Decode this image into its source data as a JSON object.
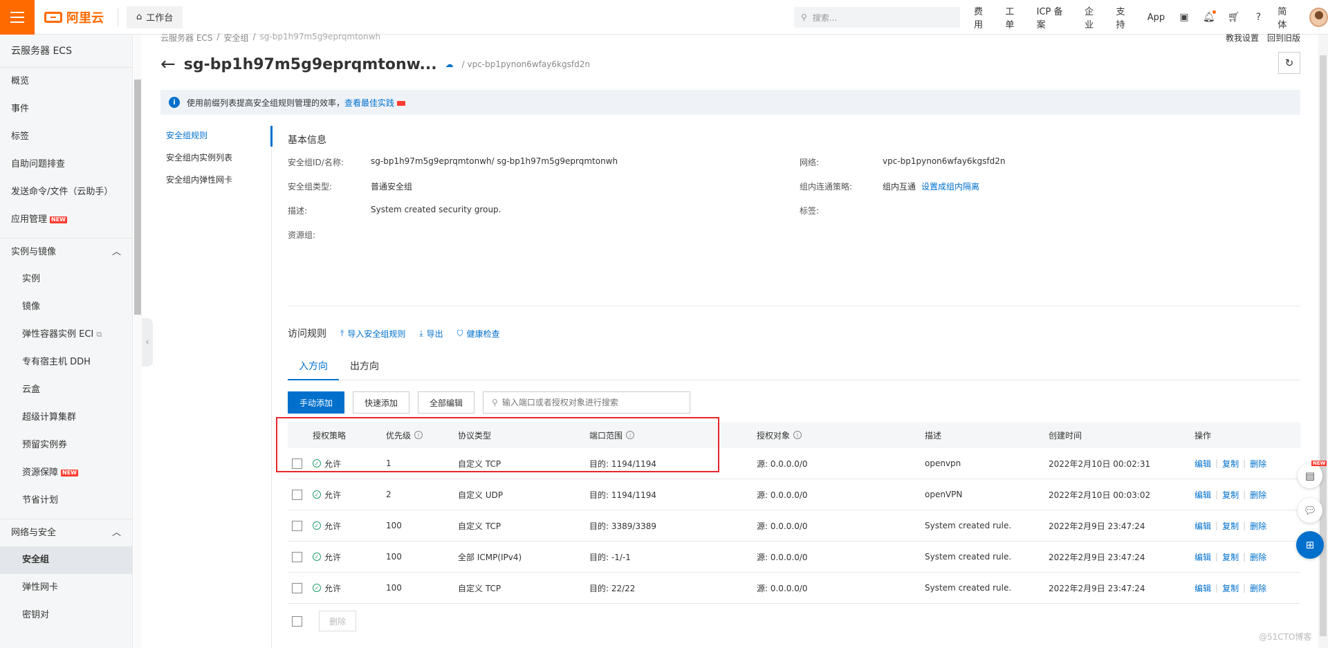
{
  "topbar": {
    "logo_text": "阿里云",
    "workbench_label": "工作台",
    "search_placeholder": "搜索...",
    "links": [
      "费用",
      "工单",
      "ICP 备案",
      "企业",
      "支持",
      "App"
    ],
    "lang": "简体"
  },
  "leftnav": {
    "title": "云服务器 ECS",
    "top_items": [
      {
        "label": "概览"
      },
      {
        "label": "事件"
      },
      {
        "label": "标签"
      },
      {
        "label": "自助问题排查"
      },
      {
        "label": "发送命令/文件（云助手）"
      },
      {
        "label": "应用管理",
        "badge": "NEW"
      }
    ],
    "groups": [
      {
        "label": "实例与镜像",
        "items": [
          {
            "label": "实例"
          },
          {
            "label": "镜像"
          },
          {
            "label": "弹性容器实例 ECI"
          },
          {
            "label": "专有宿主机 DDH"
          },
          {
            "label": "云盒"
          },
          {
            "label": "超级计算集群"
          },
          {
            "label": "预留实例券"
          },
          {
            "label": "资源保障",
            "badge": "NEW"
          },
          {
            "label": "节省计划"
          }
        ]
      },
      {
        "label": "网络与安全",
        "items": [
          {
            "label": "安全组",
            "active": true
          },
          {
            "label": "弹性网卡"
          },
          {
            "label": "密钥对"
          }
        ]
      }
    ]
  },
  "breadcrumb": [
    "云服务器 ECS",
    "安全组",
    "sg-bp1h97m5g9eprqmtonwh"
  ],
  "top_right_links": [
    "教我设置",
    "回到旧版"
  ],
  "page": {
    "title": "sg-bp1h97m5g9eprqmtonw...",
    "vpc": "/ vpc-bp1pynon6wfay6kgsfd2n"
  },
  "info_bar": {
    "text": "使用前缀列表提高安全组规则管理的效率，",
    "link": "查看最佳实践"
  },
  "subnav": [
    "安全组规则",
    "安全组内实例列表",
    "安全组内弹性网卡"
  ],
  "basic_info": {
    "title": "基本信息",
    "fields": [
      {
        "label": "安全组ID/名称:",
        "value": "sg-bp1h97m5g9eprqmtonwh/ sg-bp1h97m5g9eprqmtonwh"
      },
      {
        "label": "网络:",
        "value": "vpc-bp1pynon6wfay6kgsfd2n"
      },
      {
        "label": "安全组类型:",
        "value": "普通安全组"
      },
      {
        "label": "组内连通策略:",
        "value": "组内互通",
        "link": "设置成组内隔离"
      },
      {
        "label": "描述:",
        "value": "System created security group."
      },
      {
        "label": "标签:",
        "value": ""
      },
      {
        "label": "资源组:",
        "value": ""
      }
    ]
  },
  "rules": {
    "title": "访问规则",
    "actions": [
      "导入安全组规则",
      "导出",
      "健康检查"
    ],
    "tabs": [
      "入方向",
      "出方向"
    ],
    "buttons": [
      "手动添加",
      "快速添加",
      "全部编辑"
    ],
    "search_placeholder": "输入端口或者授权对象进行搜索",
    "columns": [
      "授权策略",
      "优先级",
      "协议类型",
      "端口范围",
      "授权对象",
      "描述",
      "创建时间",
      "操作"
    ],
    "rows": [
      {
        "policy": "允许",
        "priority": "1",
        "protocol": "自定义 TCP",
        "port": "目的: 1194/1194",
        "auth": "源: 0.0.0.0/0",
        "desc": "openvpn",
        "time": "2022年2月10日 00:02:31"
      },
      {
        "policy": "允许",
        "priority": "2",
        "protocol": "自定义 UDP",
        "port": "目的: 1194/1194",
        "auth": "源: 0.0.0.0/0",
        "desc": "openVPN",
        "time": "2022年2月10日 00:03:02"
      },
      {
        "policy": "允许",
        "priority": "100",
        "protocol": "自定义 TCP",
        "port": "目的: 3389/3389",
        "auth": "源: 0.0.0.0/0",
        "desc": "System created rule.",
        "time": "2022年2月9日 23:47:24"
      },
      {
        "policy": "允许",
        "priority": "100",
        "protocol": "全部 ICMP(IPv4)",
        "port": "目的: -1/-1",
        "auth": "源: 0.0.0.0/0",
        "desc": "System created rule.",
        "time": "2022年2月9日 23:47:24"
      },
      {
        "policy": "允许",
        "priority": "100",
        "protocol": "自定义 TCP",
        "port": "目的: 22/22",
        "auth": "源: 0.0.0.0/0",
        "desc": "System created rule.",
        "time": "2022年2月9日 23:47:24"
      }
    ],
    "ops": [
      "编辑",
      "复制",
      "删除"
    ],
    "delete_button": "删除"
  },
  "watermark": "@51CTO博客",
  "colors": {
    "accent": "#0070cc",
    "brand": "#ff6a00",
    "highlight": "#e8262b"
  }
}
